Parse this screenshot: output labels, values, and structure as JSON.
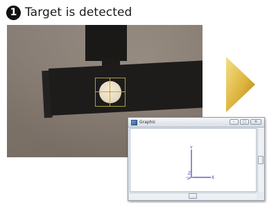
{
  "step": {
    "number": "1",
    "title": "Target is detected"
  },
  "graphic_window": {
    "title": "Graphic",
    "controls": {
      "minimize": "–",
      "maximize": "□",
      "close": "✕"
    },
    "axes": {
      "y_label": "Y",
      "x_label": "X",
      "z_label": "Z"
    }
  },
  "colors": {
    "arrow_light": "#f0d470",
    "arrow_dark": "#b98a1e",
    "axis_color": "#4040b0",
    "detect_box": "#a6a03a"
  },
  "icons": {
    "next_arrow": "triangle-right-icon",
    "window_app": "graphic-app-icon"
  }
}
